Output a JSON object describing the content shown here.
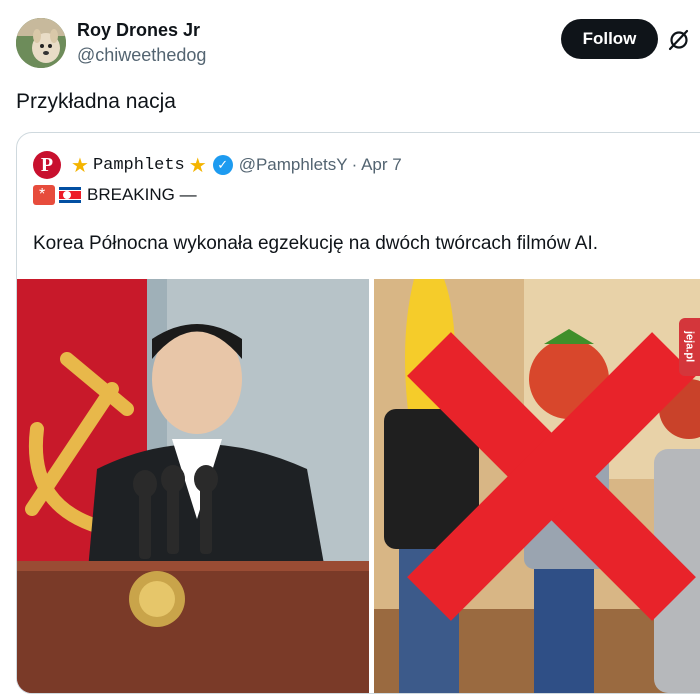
{
  "tweet": {
    "author_name": "Roy Drones Jr",
    "author_handle": "@chiweethedog",
    "follow_label": "Follow",
    "text": "Przykładna nacja"
  },
  "quote": {
    "logo_letter": "P",
    "name": "Pamphlets",
    "handle": "@PamphletsY",
    "date": "· Apr 7",
    "breaking": "BREAKING —",
    "text": "Korea Północna wykonała egzekucję na dwóch twórcach filmów AI."
  },
  "watermark": "jeja.pl",
  "colors": {
    "follow_bg": "#0f1419",
    "verified": "#1d9bf0",
    "star": "#f4b400",
    "cross": "#e8232a"
  },
  "icons": [
    "avatar-dog",
    "grok-icon",
    "pamphlets-logo",
    "star-icon",
    "verified-icon",
    "siren-icon",
    "north-korea-flag-icon"
  ]
}
